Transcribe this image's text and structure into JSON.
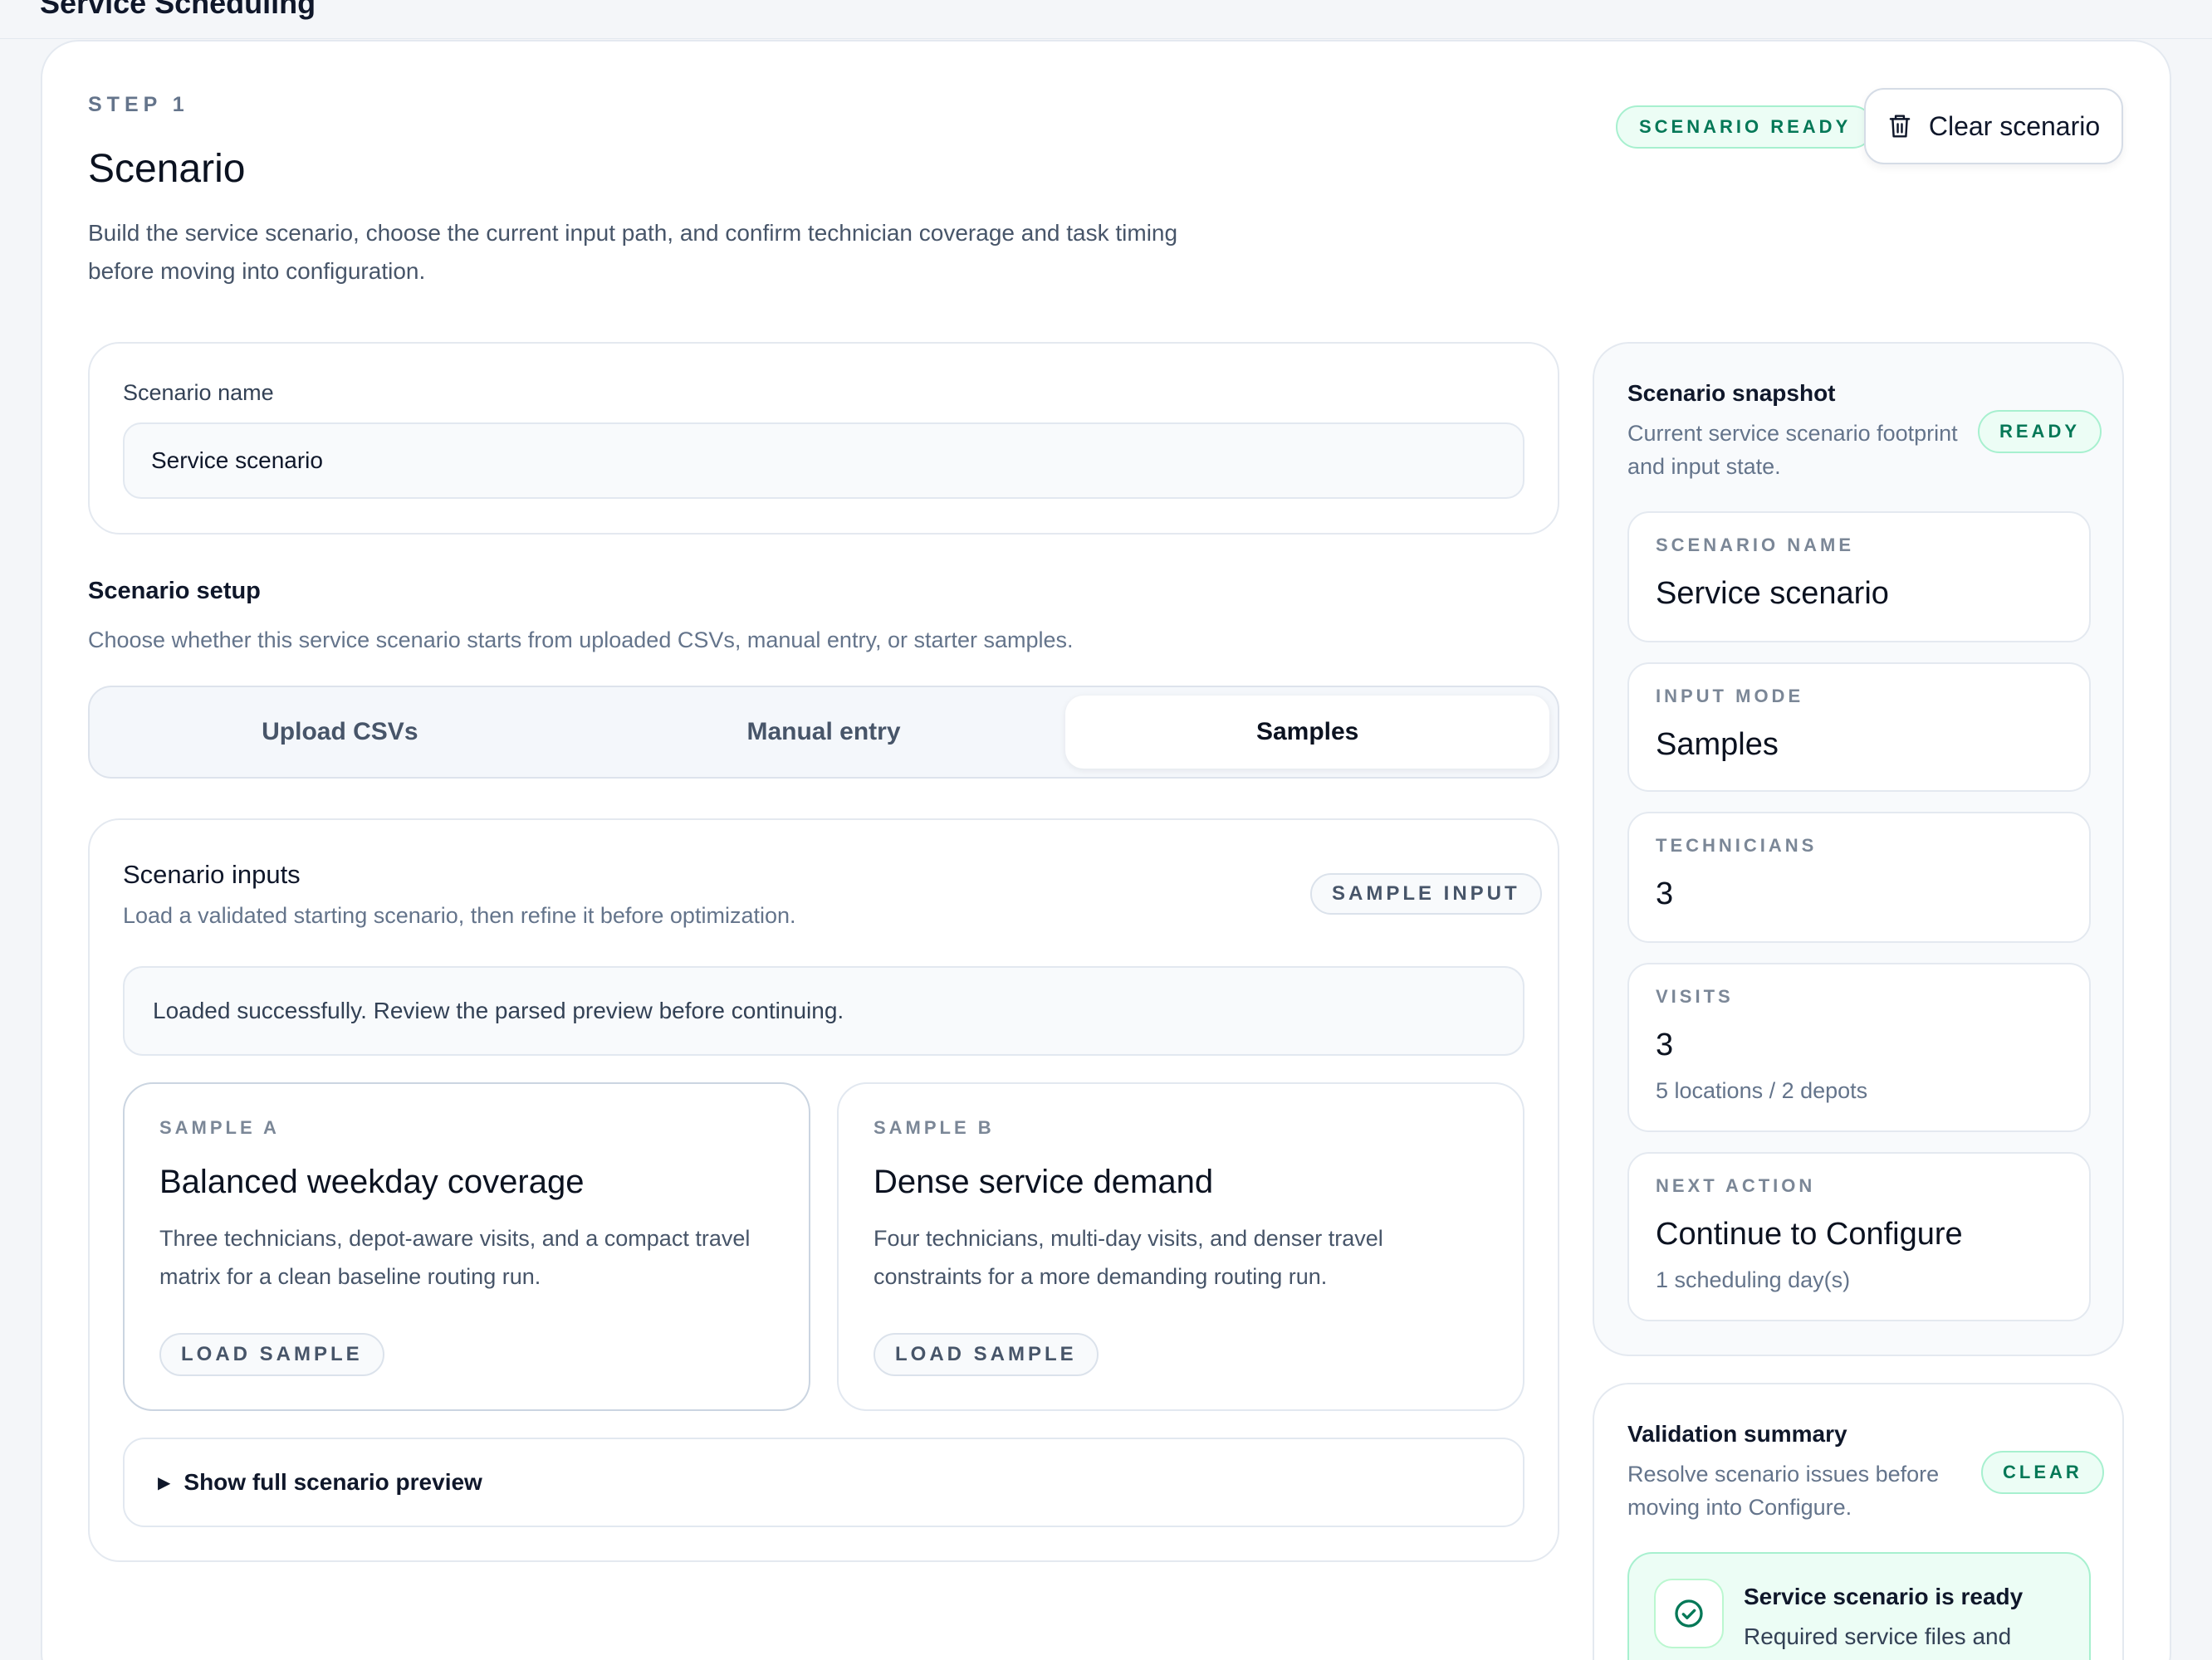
{
  "app": {
    "title": "Service Scheduling"
  },
  "header": {
    "step": "STEP 1",
    "title": "Scenario",
    "description": "Build the service scenario, choose the current input path, and confirm technician coverage and task timing before moving into configuration.",
    "status": "SCENARIO READY",
    "clear_label": "Clear scenario"
  },
  "name_field": {
    "label": "Scenario name",
    "value": "Service scenario"
  },
  "setup": {
    "title": "Scenario setup",
    "description": "Choose whether this service scenario starts from uploaded CSVs, manual entry, or starter samples.",
    "tabs": [
      {
        "label": "Upload CSVs"
      },
      {
        "label": "Manual entry"
      },
      {
        "label": "Samples"
      }
    ],
    "active_tab": "Samples"
  },
  "inputs": {
    "title": "Scenario inputs",
    "description": "Load a validated starting scenario, then refine it before optimization.",
    "badge": "SAMPLE INPUT",
    "notice": "Loaded successfully. Review the parsed preview before continuing.",
    "samples": [
      {
        "tag": "SAMPLE A",
        "title": "Balanced weekday coverage",
        "description": "Three technicians, depot-aware visits, and a compact travel matrix for a clean baseline routing run.",
        "button": "LOAD SAMPLE"
      },
      {
        "tag": "SAMPLE B",
        "title": "Dense service demand",
        "description": "Four technicians, multi-day visits, and denser travel constraints for a more demanding routing run.",
        "button": "LOAD SAMPLE"
      }
    ],
    "preview_toggle": "Show full scenario preview"
  },
  "snapshot": {
    "title": "Scenario snapshot",
    "description": "Current service scenario footprint and input state.",
    "badge": "READY",
    "stats": [
      {
        "label": "SCENARIO NAME",
        "value": "Service scenario"
      },
      {
        "label": "INPUT MODE",
        "value": "Samples"
      },
      {
        "label": "TECHNICIANS",
        "value": "3"
      },
      {
        "label": "VISITS",
        "value": "3",
        "sub": "5 locations / 2 depots"
      },
      {
        "label": "NEXT ACTION",
        "value": "Continue to Configure",
        "sub": "1 scheduling day(s)"
      }
    ]
  },
  "validation": {
    "title": "Validation summary",
    "description": "Resolve scenario issues before moving into Configure.",
    "badge": "CLEAR",
    "ready_title": "Service scenario is ready",
    "ready_desc": "Required service files and"
  },
  "colors": {
    "accent_green": "#047857",
    "green_bg": "#ecfdf5",
    "muted": "#64748b"
  }
}
